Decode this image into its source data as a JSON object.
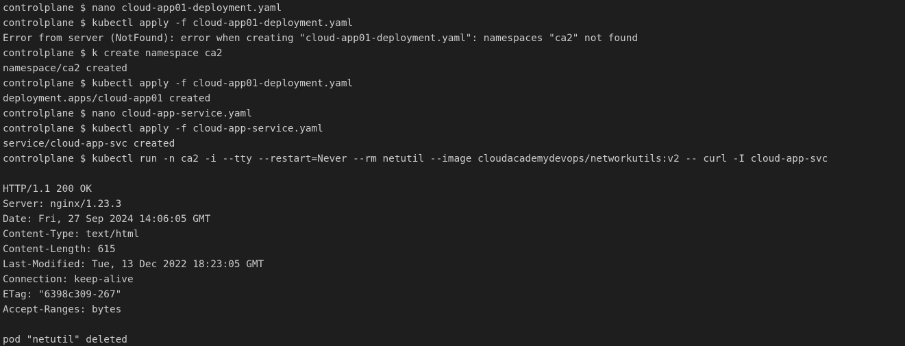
{
  "terminal": {
    "lines": [
      "controlplane $ nano cloud-app01-deployment.yaml",
      "controlplane $ kubectl apply -f cloud-app01-deployment.yaml",
      "Error from server (NotFound): error when creating \"cloud-app01-deployment.yaml\": namespaces \"ca2\" not found",
      "controlplane $ k create namespace ca2",
      "namespace/ca2 created",
      "controlplane $ kubectl apply -f cloud-app01-deployment.yaml",
      "deployment.apps/cloud-app01 created",
      "controlplane $ nano cloud-app-service.yaml",
      "controlplane $ kubectl apply -f cloud-app-service.yaml",
      "service/cloud-app-svc created",
      "controlplane $ kubectl run -n ca2 -i --tty --restart=Never --rm netutil --image cloudacademydevops/networkutils:v2 -- curl -I cloud-app-svc",
      "",
      "HTTP/1.1 200 OK",
      "Server: nginx/1.23.3",
      "Date: Fri, 27 Sep 2024 14:06:05 GMT",
      "Content-Type: text/html",
      "Content-Length: 615",
      "Last-Modified: Tue, 13 Dec 2022 18:23:05 GMT",
      "Connection: keep-alive",
      "ETag: \"6398c309-267\"",
      "Accept-Ranges: bytes",
      "",
      "pod \"netutil\" deleted"
    ]
  },
  "colors": {
    "background": "#1e1e1e",
    "foreground": "#cccccc"
  }
}
